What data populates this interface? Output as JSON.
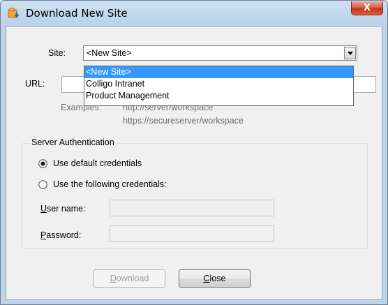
{
  "window": {
    "title": "Download New Site",
    "close_glyph": "X"
  },
  "site": {
    "label_prefix": "Site:",
    "selected": "<New Site>",
    "options": [
      "<New Site>",
      "Colligo Intranet",
      "Product Management"
    ]
  },
  "url": {
    "label": "URL:",
    "value": ""
  },
  "examples": {
    "label": "Examples:",
    "line1": "http://server/workspace",
    "line2": "https://secureserver/workspace"
  },
  "auth": {
    "group_title": "Server Authentication",
    "default_label": "Use default credentials",
    "custom_label": "Use the following credentials:",
    "selected": "default",
    "username_label_key": "U",
    "username_label_rest": "ser name:",
    "password_label_key": "P",
    "password_label_rest": "assword:",
    "username_value": "",
    "password_value": ""
  },
  "buttons": {
    "download_key": "D",
    "download_rest": "ownload",
    "close_key": "C",
    "close_rest": "lose"
  },
  "colors": {
    "selection": "#3399ff",
    "close_button": "#c7412a"
  },
  "icons": [
    "app-icon",
    "close-icon",
    "chevron-down-icon"
  ]
}
